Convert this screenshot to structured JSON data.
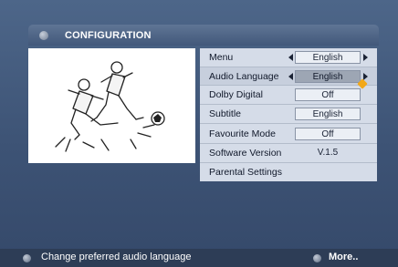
{
  "title_bar": {
    "title": "CONFIGURATION",
    "icon": "menu-ball-icon"
  },
  "preview": {
    "description_icon": "football-players-illustration"
  },
  "settings": {
    "menu": {
      "label": "Menu",
      "value": "English"
    },
    "audio_language": {
      "label": "Audio Language",
      "value": "English"
    },
    "dolby_digital": {
      "label": "Dolby Digital",
      "value": "Off"
    },
    "subtitle": {
      "label": "Subtitle",
      "value": "English"
    },
    "favourite_mode": {
      "label": "Favourite Mode",
      "value": "Off"
    },
    "software_version": {
      "label": "Software Version",
      "value": "V.1.5"
    },
    "parental_settings": {
      "label": "Parental Settings"
    }
  },
  "footer": {
    "hint": "Change preferred audio language",
    "more": "More.."
  },
  "colors": {
    "background": "#3e5272",
    "panel": "#d5dce8",
    "highlight_box": "#9da6b4",
    "cursor": "#f2a818"
  }
}
